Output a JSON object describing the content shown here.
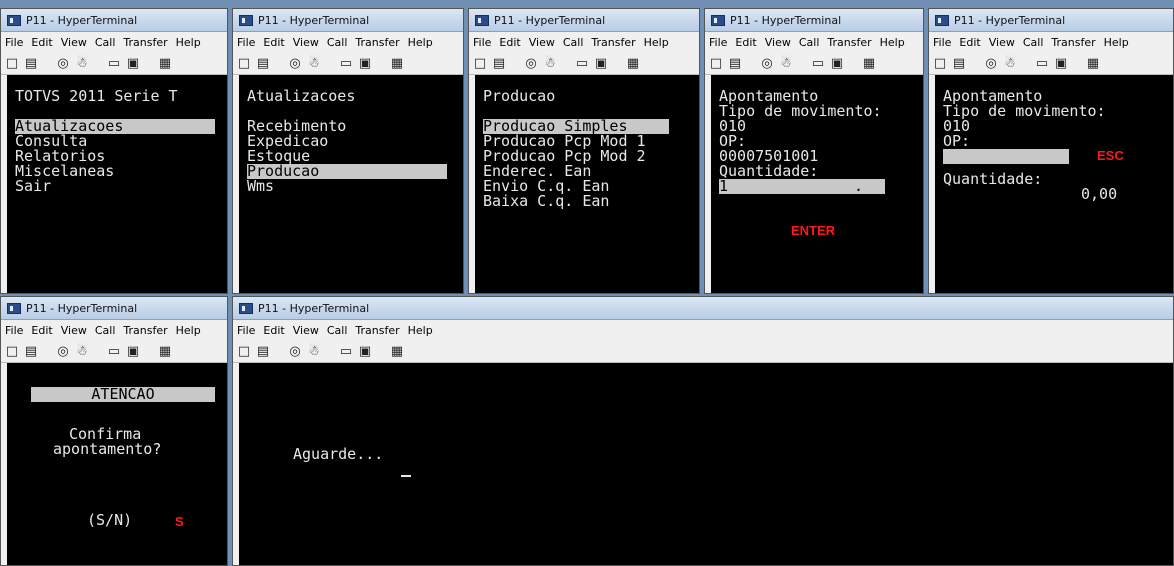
{
  "window_title": "P11 - HyperTerminal",
  "menu": [
    "File",
    "Edit",
    "View",
    "Call",
    "Transfer",
    "Help"
  ],
  "toolbar_icons": [
    "new-icon",
    "open-icon",
    "disconnect-icon",
    "dial-icon",
    "send-icon",
    "receive-icon",
    "properties-icon"
  ],
  "toolbar_glyphs": [
    "□",
    "▤",
    "◎",
    "☃",
    "▭",
    "▣",
    "▦"
  ],
  "win1": {
    "header": "TOTVS 2011 Serie T",
    "items": [
      "Atualizacoes",
      "Consulta",
      "Relatorios",
      "Miscelaneas",
      "Sair"
    ]
  },
  "win2": {
    "header": "Atualizacoes",
    "items": [
      "Recebimento",
      "Expedicao",
      "Estoque",
      "Producao",
      "Wms"
    ]
  },
  "win3": {
    "header": "Producao",
    "items": [
      "Producao Simples",
      "Producao Pcp Mod 1",
      "Producao Pcp Mod 2",
      "Enderec. Ean",
      "Envio C.q. Ean",
      "Baixa C.q. Ean"
    ]
  },
  "win4": {
    "lines": [
      "Apontamento",
      "Tipo de movimento:",
      "010",
      "OP:",
      "00007501001",
      "Quantidade:"
    ],
    "quantity_value": "1",
    "quantity_dot": ".",
    "annotation": "ENTER"
  },
  "win5": {
    "lines": [
      "Apontamento",
      "Tipo de movimento:",
      "010",
      "OP:"
    ],
    "op_value": "",
    "quantity_label": "Quantidade:",
    "quantity_value": "0,00",
    "annotation": "ESC"
  },
  "win6": {
    "header": "ATENCAO",
    "line1": "Confirma",
    "line2": "apontamento?",
    "prompt": "(S/N)",
    "annotation": "S"
  },
  "win7": {
    "message": "Aguarde..."
  },
  "colors": {
    "terminal_bg": "#000000",
    "terminal_fg": "#e8e8e8",
    "highlight": "#c8c8c8",
    "annotation": "#ff1a1a"
  }
}
